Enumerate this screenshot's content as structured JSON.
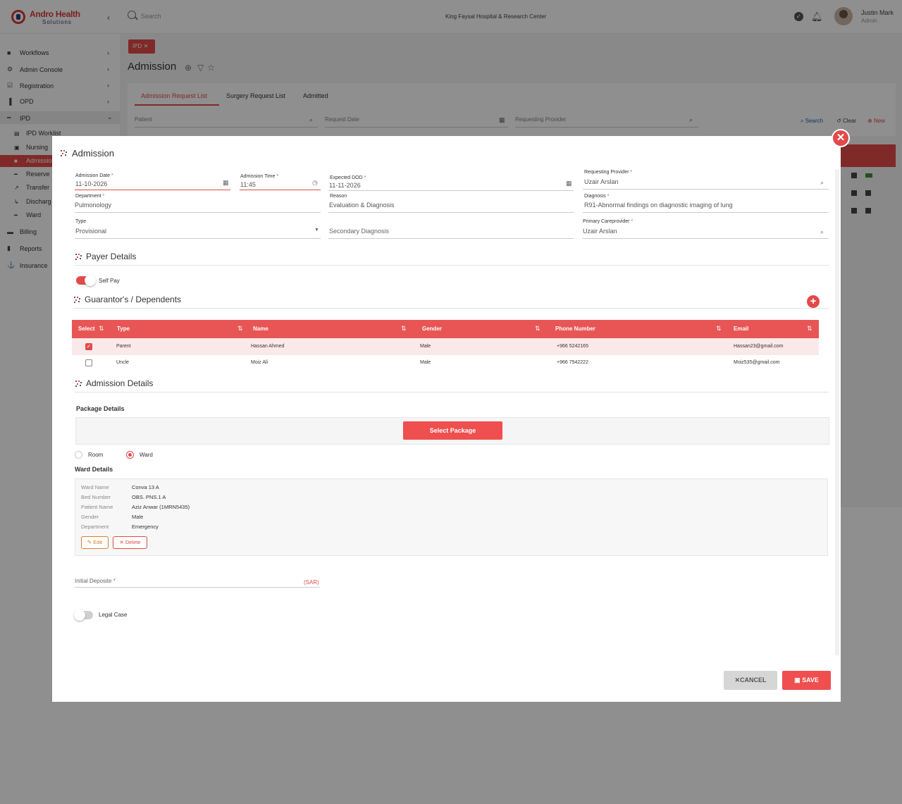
{
  "brand": {
    "name": "Andro Health",
    "tagline": "Solutions"
  },
  "topbar": {
    "search_placeholder": "Search",
    "hospital": "King Faysal Hospital & Research Center",
    "user_name": "Justin Mark",
    "user_role": "Admin"
  },
  "sidebar": {
    "items": [
      {
        "label": "Workflows",
        "icon": "workflow-icon"
      },
      {
        "label": "Admin Console",
        "icon": "gear-icon"
      },
      {
        "label": "Registration",
        "icon": "checkbox-icon"
      },
      {
        "label": "OPD",
        "icon": "chart-icon"
      },
      {
        "label": "IPD",
        "icon": "bed-icon"
      }
    ],
    "ipd_sub": [
      {
        "label": "IPD Worklist"
      },
      {
        "label": "Nursing"
      },
      {
        "label": "Admissio"
      },
      {
        "label": "Reserve"
      },
      {
        "label": "Transfer"
      },
      {
        "label": "Discharg"
      },
      {
        "label": "Ward"
      }
    ],
    "bottom": [
      {
        "label": "Billing"
      },
      {
        "label": "Reports"
      },
      {
        "label": "Insurance"
      }
    ]
  },
  "page": {
    "chip": "IPD",
    "title": "Admission",
    "tabs": [
      "Admission Request List",
      "Surgery Request List",
      "Admitted"
    ],
    "filters": {
      "patient": "Patient",
      "request_date": "Request Date",
      "requesting_provider": "Requesting Provider"
    },
    "actions": {
      "search": "Search",
      "clear": "Clear",
      "new": "New"
    }
  },
  "modal": {
    "title": "Admission",
    "fields": {
      "admission_date": {
        "label": "Admission Date",
        "value": "11-10-2026"
      },
      "admission_time": {
        "label": "Admission Time",
        "value": "11:45"
      },
      "expected_dod": {
        "label": "Expected DOD",
        "value": "11-11-2026"
      },
      "requesting_provider": {
        "label": "Requesting Provider",
        "value": "Uzair Arslan"
      },
      "department": {
        "label": "Department",
        "value": "Pulmonology"
      },
      "reason": {
        "label": "Reason",
        "value": "Evaluation & Diagnosis"
      },
      "diagnosis": {
        "label": "Diagnosis",
        "value": "R91-Abnormal findings on diagnostic imaging of lung"
      },
      "type": {
        "label": "Type",
        "value": "Provisional"
      },
      "secondary_diagnosis": {
        "placeholder": "Secondary Diagnosis"
      },
      "primary_careprovider": {
        "label": "Primary Careprovider",
        "value": "Uzair Arslan"
      }
    },
    "payer": {
      "title": "Payer Details",
      "self_pay_label": "Self Pay",
      "self_pay": true
    },
    "guarantors": {
      "title": "Guarantor's / Dependents",
      "columns": [
        "Select",
        "Type",
        "Name",
        "Gender",
        "Phone Number",
        "Email"
      ],
      "rows": [
        {
          "selected": true,
          "type": "Parent",
          "name": "Hassan Ahmed",
          "gender": "Male",
          "phone": "+966 5242165",
          "email": "Hassan23@gmail.com"
        },
        {
          "selected": false,
          "type": "Uncle",
          "name": "Moiz Ali",
          "gender": "Male",
          "phone": "+966 7542222",
          "email": "Moiz535@gmail.com"
        }
      ]
    },
    "admission_details": {
      "title": "Admission Details",
      "package_heading": "Package Details",
      "select_package": "Select Package",
      "room_label": "Room",
      "ward_label": "Ward",
      "selected_option": "Ward",
      "ward_heading": "Ward Details",
      "ward": [
        {
          "key": "Ward Name",
          "value": "Conva 13 A"
        },
        {
          "key": "Bed Number",
          "value": "OBS. PNS.1 A"
        },
        {
          "key": "Patient Name",
          "value": "Aziz Anwar (1MRN5435)"
        },
        {
          "key": "Gender",
          "value": "Male"
        },
        {
          "key": "Department",
          "value": "Emergency"
        }
      ],
      "edit_label": "Edit",
      "delete_label": "Delete",
      "initial_deposit_label": "Initial Deposite",
      "currency": "(SAR)",
      "legal_case_label": "Legal Case",
      "legal_case": false
    },
    "buttons": {
      "cancel": "CANCEL",
      "save": "SAVE"
    }
  },
  "colors": {
    "accent": "#e24a4a",
    "header_row": "#e85555",
    "selected_row": "#fbe9e9"
  }
}
